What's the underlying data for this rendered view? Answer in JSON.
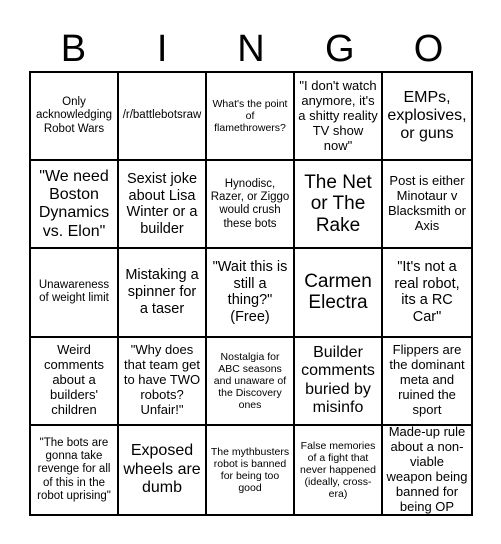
{
  "header": {
    "letters": [
      "B",
      "I",
      "N",
      "G",
      "O"
    ]
  },
  "cells": [
    "Only acknowledging Robot Wars",
    "/r/battlebotsraw",
    "What's the point of flamethrowers?",
    "\"I don't watch anymore, it's a shitty reality TV show now\"",
    "EMPs, explosives, or guns",
    "\"We need Boston Dynamics vs. Elon\"",
    "Sexist joke about Lisa Winter or a builder",
    "Hynodisc, Razer, or Ziggo would crush these bots",
    "The Net or The Rake",
    "Post is either Minotaur v Blacksmith or Axis",
    "Unawareness of weight limit",
    "Mistaking a spinner for a taser",
    "\"Wait this is still a thing?\" (Free)",
    "Carmen Electra",
    "\"It's not a real robot, its a RC Car\"",
    "Weird comments about a builders' children",
    "\"Why does that team get to have TWO robots? Unfair!\"",
    "Nostalgia for ABC seasons and unaware of the Discovery ones",
    "Builder comments buried by misinfo",
    "Flippers are the dominant meta and ruined the sport",
    "\"The bots are gonna take revenge for all of this in the robot uprising\"",
    "Exposed wheels are dumb",
    "The mythbusters robot is banned for being too good",
    "False memories of a fight that never happened (ideally, cross-era)",
    "Made-up rule about a non-viable weapon being banned for being OP"
  ],
  "free_cell_index": 12
}
